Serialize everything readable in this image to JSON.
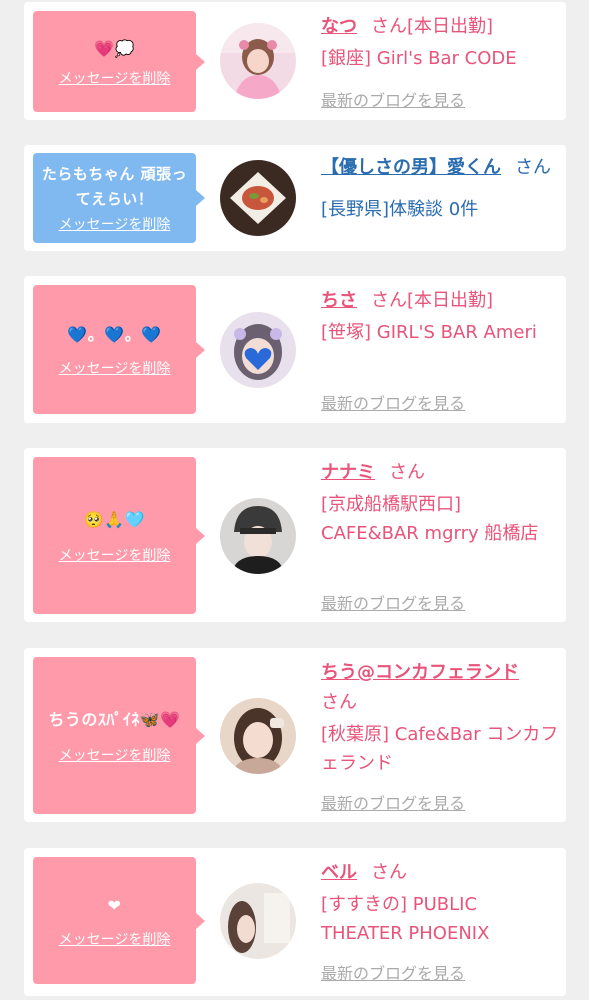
{
  "delete_label": "メッセージを削除",
  "blog_label": "最新のブログを見る",
  "san_label": "さん",
  "cards": [
    {
      "message": "💗💭",
      "name": "なつ",
      "status": "[本日出勤]",
      "place": "[銀座] Girl's Bar CODE",
      "avatar_icon": "avatar-pink-dress"
    },
    {
      "message": "たらもちゃん 頑張ってえらい！",
      "name": "【優しさの男】愛くん",
      "place": "[長野県]体験談 0件",
      "avatar_icon": "avatar-food-plate"
    },
    {
      "message": "💙。💙。💙",
      "name": "ちさ",
      "status": "[本日出勤]",
      "place": "[笹塚] GIRL'S BAR Ameri",
      "avatar_icon": "avatar-heart-face"
    },
    {
      "message": "🥺🙏🩵",
      "name": "ナナミ",
      "place": "[京成船橋駅西口] CAFE&BAR mgrry 船橋店",
      "avatar_icon": "avatar-beanie"
    },
    {
      "message": "ちうのｽﾊﾟｲﾈ🦋💗",
      "name": "ちう@コンカフェランド",
      "place": "[秋葉原] Cafe&Bar コンカフェランド",
      "avatar_icon": "avatar-girl"
    },
    {
      "message": "❤",
      "name": "ベル",
      "place": "[すすきの] PUBLIC THEATER PHOENIX",
      "avatar_icon": "avatar-girl-light"
    }
  ]
}
